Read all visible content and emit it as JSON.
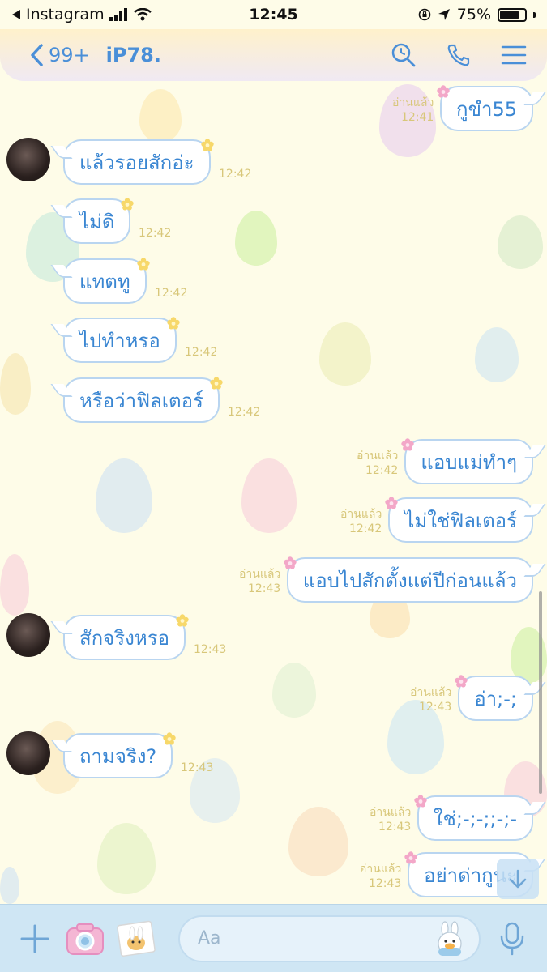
{
  "status_bar": {
    "back_app": "Instagram",
    "time": "12:45",
    "battery_percent": "75%",
    "battery_level": 0.75
  },
  "header": {
    "back_count": "99+",
    "chat_name": "iP78.",
    "icons": [
      "search-icon",
      "phone-icon",
      "menu-icon"
    ]
  },
  "messages": [
    {
      "dir": "out",
      "text": "กูขำ55",
      "read": "อ่านแล้ว",
      "time": "12:41"
    },
    {
      "dir": "in",
      "text": "แล้วรอยสักอ่ะ",
      "time": "12:42",
      "avatar": true
    },
    {
      "dir": "in",
      "text": "ไม่ดิ",
      "time": "12:42"
    },
    {
      "dir": "in",
      "text": "แทตทู",
      "time": "12:42"
    },
    {
      "dir": "in",
      "text": "ไปทำหรอ",
      "time": "12:42"
    },
    {
      "dir": "in",
      "text": "หรือว่าฟิลเตอร์",
      "time": "12:42"
    },
    {
      "dir": "out",
      "text": "แอบแม่ทำๆ",
      "read": "อ่านแล้ว",
      "time": "12:42"
    },
    {
      "dir": "out",
      "text": "ไม่ใช่ฟิลเตอร์",
      "read": "อ่านแล้ว",
      "time": "12:42"
    },
    {
      "dir": "out",
      "text": "แอบไปสักตั้งแต่ปีก่อนแล้ว",
      "read": "อ่านแล้ว",
      "time": "12:43"
    },
    {
      "dir": "in",
      "text": "สักจริงหรอ",
      "time": "12:43",
      "avatar": true
    },
    {
      "dir": "out",
      "text": "อ่า;-;",
      "read": "อ่านแล้ว",
      "time": "12:43"
    },
    {
      "dir": "in",
      "text": "ถามจริง?",
      "time": "12:43",
      "avatar": true
    },
    {
      "dir": "out",
      "text": "ใช่;-;-;;-;-",
      "read": "อ่านแล้ว",
      "time": "12:43"
    },
    {
      "dir": "out",
      "text": "อย่าด่ากูนะ",
      "read": "อ่านแล้ว",
      "time": "12:43"
    }
  ],
  "input_bar": {
    "placeholder": "Aa",
    "icons": [
      "plus-icon",
      "camera-icon",
      "photo-icon",
      "sticker-icon",
      "microphone-icon"
    ]
  },
  "colors": {
    "bubble_text": "#3a86d2",
    "bubble_border": "#b9d5f0",
    "meta_text": "#d8c77a",
    "header_accent": "#4a8fd8",
    "background": "#fefce8"
  }
}
